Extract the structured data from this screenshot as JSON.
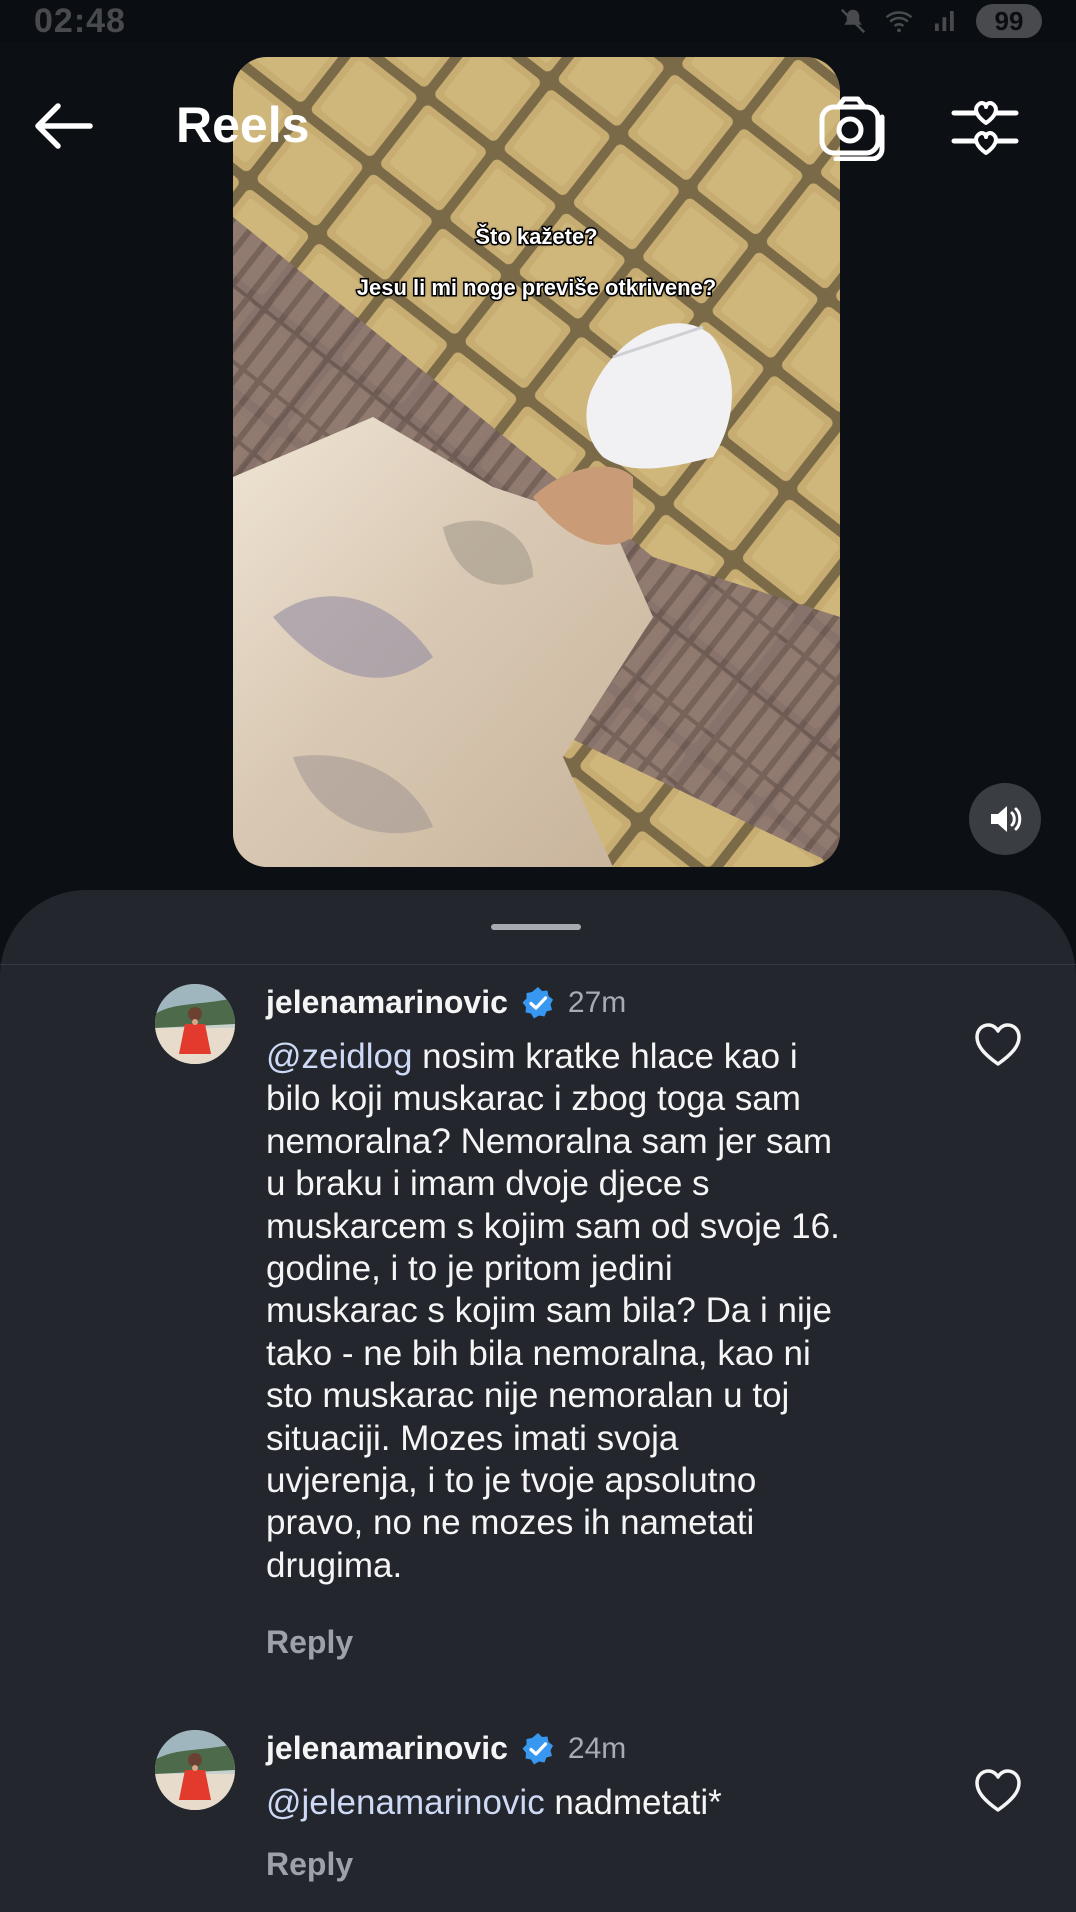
{
  "status_bar": {
    "time": "02:48",
    "battery": "99",
    "icons": [
      "mute-icon",
      "wifi-icon",
      "signal-icon"
    ]
  },
  "header": {
    "title": "Reels",
    "back_icon": "arrow-left-icon",
    "camera_icon": "camera-icon",
    "filter_icon": "heart-sliders-icon"
  },
  "video": {
    "caption_line1": "Što kažete?",
    "caption_line2": "Jesu li mi noge previše otkrivene?",
    "volume_icon": "speaker-icon"
  },
  "comments": [
    {
      "username": "jelenamarinovic",
      "verified": true,
      "timestamp": "27m",
      "mention": "@zeidlog",
      "text": " nosim kratke hlace kao i\nbilo koji muskarac i zbog toga sam\nnemoralna? Nemoralna sam jer sam\nu braku i imam dvoje djece s\nmuskarcem s kojim sam od svoje 16.\ngodine, i to je pritom jedini\nmuskarac s kojim sam bila? Da i nije\ntako - ne bih bila nemoralna, kao ni\nsto muskarac nije nemoralan u toj\nsituaciji. Mozes imati svoja\nuvjerenja, i to je tvoje apsolutno\npravo, no ne mozes ih nametati\ndrugima.",
      "reply_label": "Reply"
    },
    {
      "username": "jelenamarinovic",
      "verified": true,
      "timestamp": "24m",
      "mention": "@jelenamarinovic",
      "text": " nadmetati*",
      "reply_label": "Reply"
    }
  ],
  "colors": {
    "background": "#0c1014",
    "sheet": "#23262d",
    "verified_blue": "#3897f0",
    "secondary_text": "#a8abb2"
  }
}
